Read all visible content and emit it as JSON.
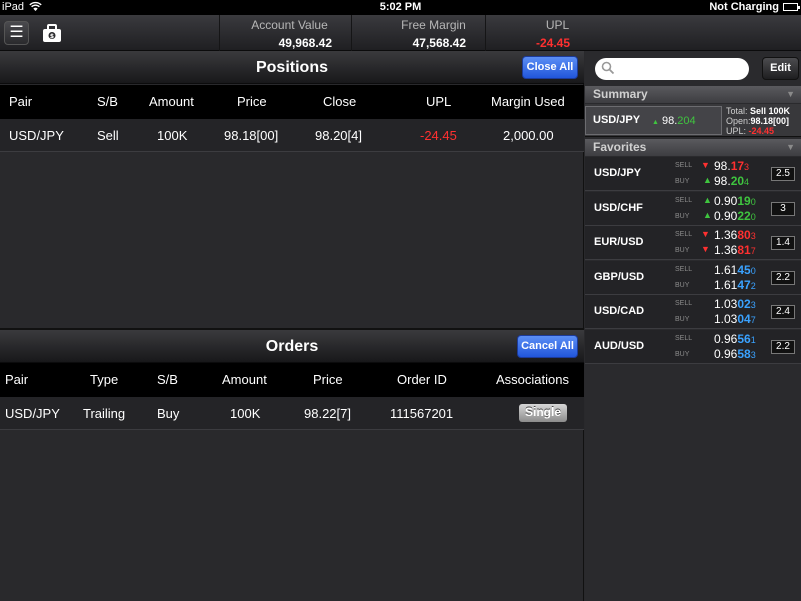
{
  "status_bar": {
    "carrier": "iPad",
    "time": "5:02 PM",
    "battery_status": "Not Charging"
  },
  "header": {
    "account_value_label": "Account Value",
    "account_value": "49,968.42",
    "free_margin_label": "Free Margin",
    "free_margin": "47,568.42",
    "upl_label": "UPL",
    "upl": "-24.45"
  },
  "positions": {
    "title": "Positions",
    "close_all_label": "Close All",
    "columns": [
      "Pair",
      "S/B",
      "Amount",
      "Price",
      "Close",
      "UPL",
      "Margin Used"
    ],
    "rows": [
      {
        "pair": "USD/JPY",
        "sb": "Sell",
        "amount": "100K",
        "price": "98.18[00]",
        "close": "98.20[4]",
        "upl": "-24.45",
        "margin_used": "2,000.00"
      }
    ]
  },
  "orders": {
    "title": "Orders",
    "cancel_all_label": "Cancel All",
    "columns": [
      "Pair",
      "Type",
      "S/B",
      "Amount",
      "Price",
      "Order ID",
      "Associations"
    ],
    "rows": [
      {
        "pair": "USD/JPY",
        "type": "Trailing",
        "sb": "Buy",
        "amount": "100K",
        "price": "98.22[7]",
        "order_id": "111567201",
        "associations": "Single"
      }
    ]
  },
  "sidebar": {
    "search_placeholder": "",
    "edit_label": "Edit",
    "summary_title": "Summary",
    "summary": {
      "pair": "USD/JPY",
      "rate_main": "98.",
      "rate_pip": "204",
      "total_label": "Total:",
      "total_value": "Sell 100K",
      "open_label": "Open:",
      "open_value": "98.18[00]",
      "upl_label": "UPL:",
      "upl_value": "-24.45"
    },
    "favorites_title": "Favorites",
    "sell_label": "SELL",
    "buy_label": "BUY",
    "favorites": [
      {
        "pair": "USD/JPY",
        "sell_main": "98.",
        "sell_pip": "17",
        "sell_frac": "3",
        "sell_dir": "down",
        "buy_main": "98.",
        "buy_pip": "20",
        "buy_frac": "4",
        "buy_dir": "up",
        "spread": "2.5"
      },
      {
        "pair": "USD/CHF",
        "sell_main": "0.90",
        "sell_pip": "19",
        "sell_frac": "0",
        "sell_dir": "up",
        "buy_main": "0.90",
        "buy_pip": "22",
        "buy_frac": "0",
        "buy_dir": "up",
        "spread": "3"
      },
      {
        "pair": "EUR/USD",
        "sell_main": "1.36",
        "sell_pip": "80",
        "sell_frac": "3",
        "sell_dir": "down",
        "buy_main": "1.36",
        "buy_pip": "81",
        "buy_frac": "7",
        "buy_dir": "down",
        "spread": "1.4"
      },
      {
        "pair": "GBP/USD",
        "sell_main": "1.61",
        "sell_pip": "45",
        "sell_frac": "0",
        "sell_dir": "none",
        "buy_main": "1.61",
        "buy_pip": "47",
        "buy_frac": "2",
        "buy_dir": "none",
        "spread": "2.2"
      },
      {
        "pair": "USD/CAD",
        "sell_main": "1.03",
        "sell_pip": "02",
        "sell_frac": "3",
        "sell_dir": "none",
        "buy_main": "1.03",
        "buy_pip": "04",
        "buy_frac": "7",
        "buy_dir": "none",
        "spread": "2.4"
      },
      {
        "pair": "AUD/USD",
        "sell_main": "0.96",
        "sell_pip": "56",
        "sell_frac": "1",
        "sell_dir": "none",
        "buy_main": "0.96",
        "buy_pip": "58",
        "buy_frac": "3",
        "buy_dir": "none",
        "spread": "2.2"
      }
    ]
  },
  "colors": {
    "negative": "#ff3030",
    "positive": "#3fc53f",
    "neutral_pip": "#3aa2ff",
    "accent_button": "#2f6be4"
  }
}
